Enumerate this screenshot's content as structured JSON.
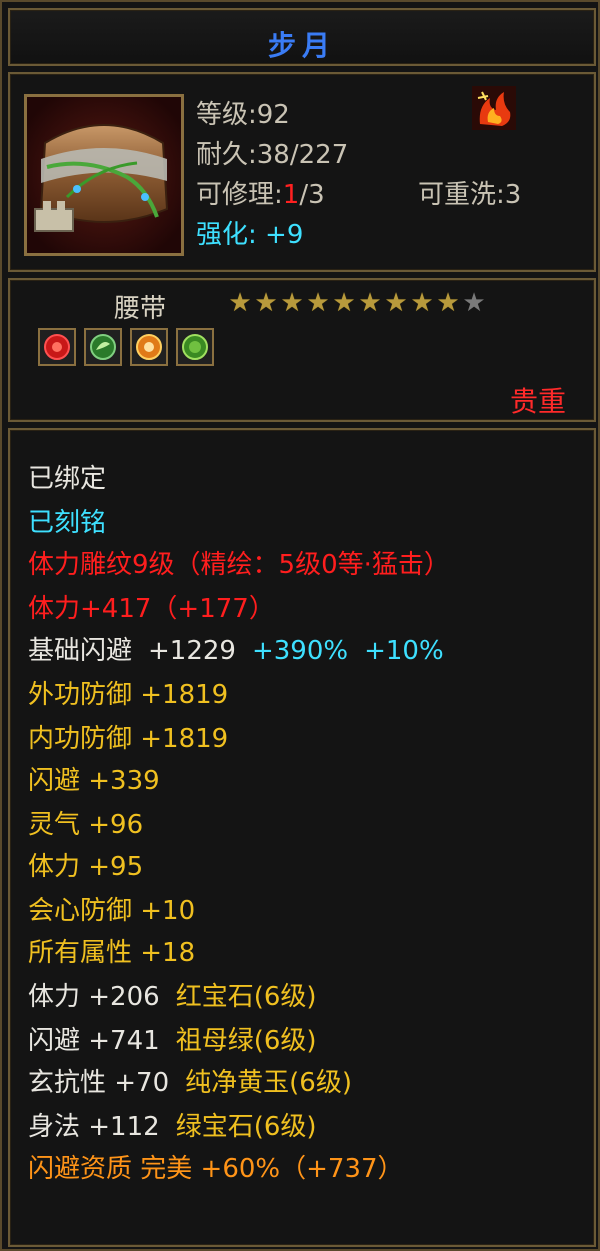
{
  "item": {
    "name": "步月",
    "type": "腰带",
    "rarity": "贵重"
  },
  "info": {
    "level": "等级:92",
    "durability": "耐久:38/227",
    "repair_prefix": "可修理:",
    "repair_current": "1",
    "repair_suffix": "/3",
    "rewash": "可重洗:3",
    "enhance_label": "强化:",
    "enhance_value": "+9"
  },
  "stars": {
    "filled": 9,
    "total": 10,
    "color_filled": "#b89a3c",
    "color_empty": "#7a7a7a"
  },
  "gems": [
    {
      "icon": "red-gem-icon",
      "color": "#d01818"
    },
    {
      "icon": "green-gem-icon",
      "color": "#3a9a3a"
    },
    {
      "icon": "orange-gem-icon",
      "color": "#e07a18"
    },
    {
      "icon": "emerald-gem-icon",
      "color": "#50b030"
    }
  ],
  "attributes": {
    "bound": "已绑定",
    "engraved": "已刻铭",
    "carving": "体力雕纹9级（精绘：5级0等·猛击）",
    "stamina_total": "体力+417（+177）",
    "base_dodge_label": "基础闪避",
    "base_dodge_value": "+1229",
    "base_dodge_bonus1": "+390%",
    "base_dodge_bonus2": "+10%",
    "lines": [
      "外功防御  +1819",
      "内功防御  +1819",
      "闪避  +339",
      "灵气  +96",
      "体力  +95",
      "会心防御  +10",
      "所有属性  +18"
    ],
    "gem_lines": [
      {
        "stat": "体力  +206",
        "gem": "红宝石(6级)"
      },
      {
        "stat": "闪避  +741",
        "gem": "祖母绿(6级)"
      },
      {
        "stat": "玄抗性  +70",
        "gem": "纯净黄玉(6级)"
      },
      {
        "stat": "身法  +112",
        "gem": "绿宝石(6级)"
      }
    ],
    "quality": "闪避资质   完美  +60%（+737）"
  },
  "colors": {
    "title": "#3a7cf5",
    "bound": "#e8e6e0",
    "engraved": "#3ee0ff",
    "carving": "#ff1e1e",
    "gold": "#f0c020",
    "quality": "#ff9418",
    "rarity": "#ff2a2a"
  }
}
